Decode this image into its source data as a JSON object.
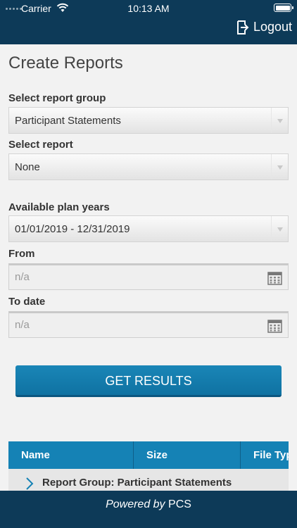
{
  "status_bar": {
    "carrier": "Carrier",
    "time": "10:13 AM"
  },
  "header": {
    "logout_label": "Logout"
  },
  "page": {
    "title": "Create Reports"
  },
  "form": {
    "report_group": {
      "label": "Select report group",
      "value": "Participant Statements"
    },
    "report": {
      "label": "Select report",
      "value": "None"
    },
    "plan_years": {
      "label": "Available plan years",
      "value": "01/01/2019 - 12/31/2019"
    },
    "from": {
      "label": "From",
      "placeholder": "n/a"
    },
    "to_date": {
      "label": "To date",
      "placeholder": "n/a"
    },
    "submit_label": "GET RESULTS"
  },
  "results_table": {
    "columns": [
      "Name",
      "Size",
      "File Type"
    ],
    "rows": [
      {
        "label": "Report Group: Participant Statements"
      }
    ]
  },
  "footer": {
    "powered_by": "Powered by",
    "company": "PCS"
  },
  "colors": {
    "header_bg": "#0d3a58",
    "accent": "#1582b5",
    "button": "#1479aa"
  }
}
